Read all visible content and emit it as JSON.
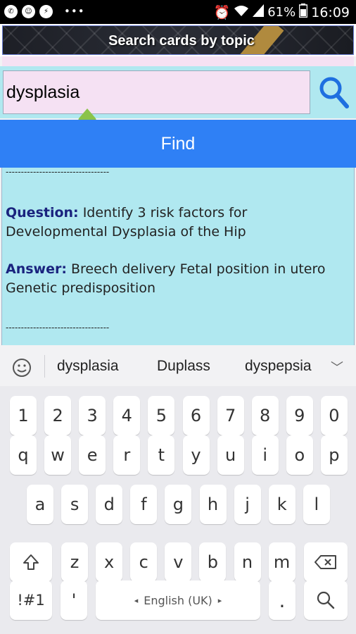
{
  "status_bar": {
    "left_icons": [
      "whatsapp-icon",
      "smile-app-icon",
      "messenger-icon"
    ],
    "more": "•••",
    "battery_percent": "61%",
    "time": "16:09"
  },
  "header": {
    "title": "Search cards by topic"
  },
  "search": {
    "value": "dysplasia"
  },
  "find_button": {
    "label": "Find"
  },
  "result": {
    "divider": "----------------------------------",
    "question_label": "Question:",
    "question_text": "Identify 3 risk factors for Developmental Dysplasia of the Hip",
    "answer_label": "Answer:",
    "answer_text": "Breech delivery Fetal position in utero Genetic predisposition"
  },
  "suggestions": [
    "dysplasia",
    "Duplass",
    "dyspepsia"
  ],
  "keyboard": {
    "row_numbers": [
      "1",
      "2",
      "3",
      "4",
      "5",
      "6",
      "7",
      "8",
      "9",
      "0"
    ],
    "row_1": [
      "q",
      "w",
      "e",
      "r",
      "t",
      "y",
      "u",
      "i",
      "o",
      "p"
    ],
    "row_2": [
      "a",
      "s",
      "d",
      "f",
      "g",
      "h",
      "j",
      "k",
      "l"
    ],
    "row_3": [
      "z",
      "x",
      "c",
      "v",
      "b",
      "n",
      "m"
    ],
    "symbols_key": "!#1",
    "apostrophe_key": "'",
    "space_label": "English (UK)",
    "period_key": "."
  },
  "colors": {
    "find_blue": "#2f80f5",
    "result_bg": "#b0e8f0",
    "input_bg": "#f5e1f3",
    "label_navy": "#1a237e"
  }
}
